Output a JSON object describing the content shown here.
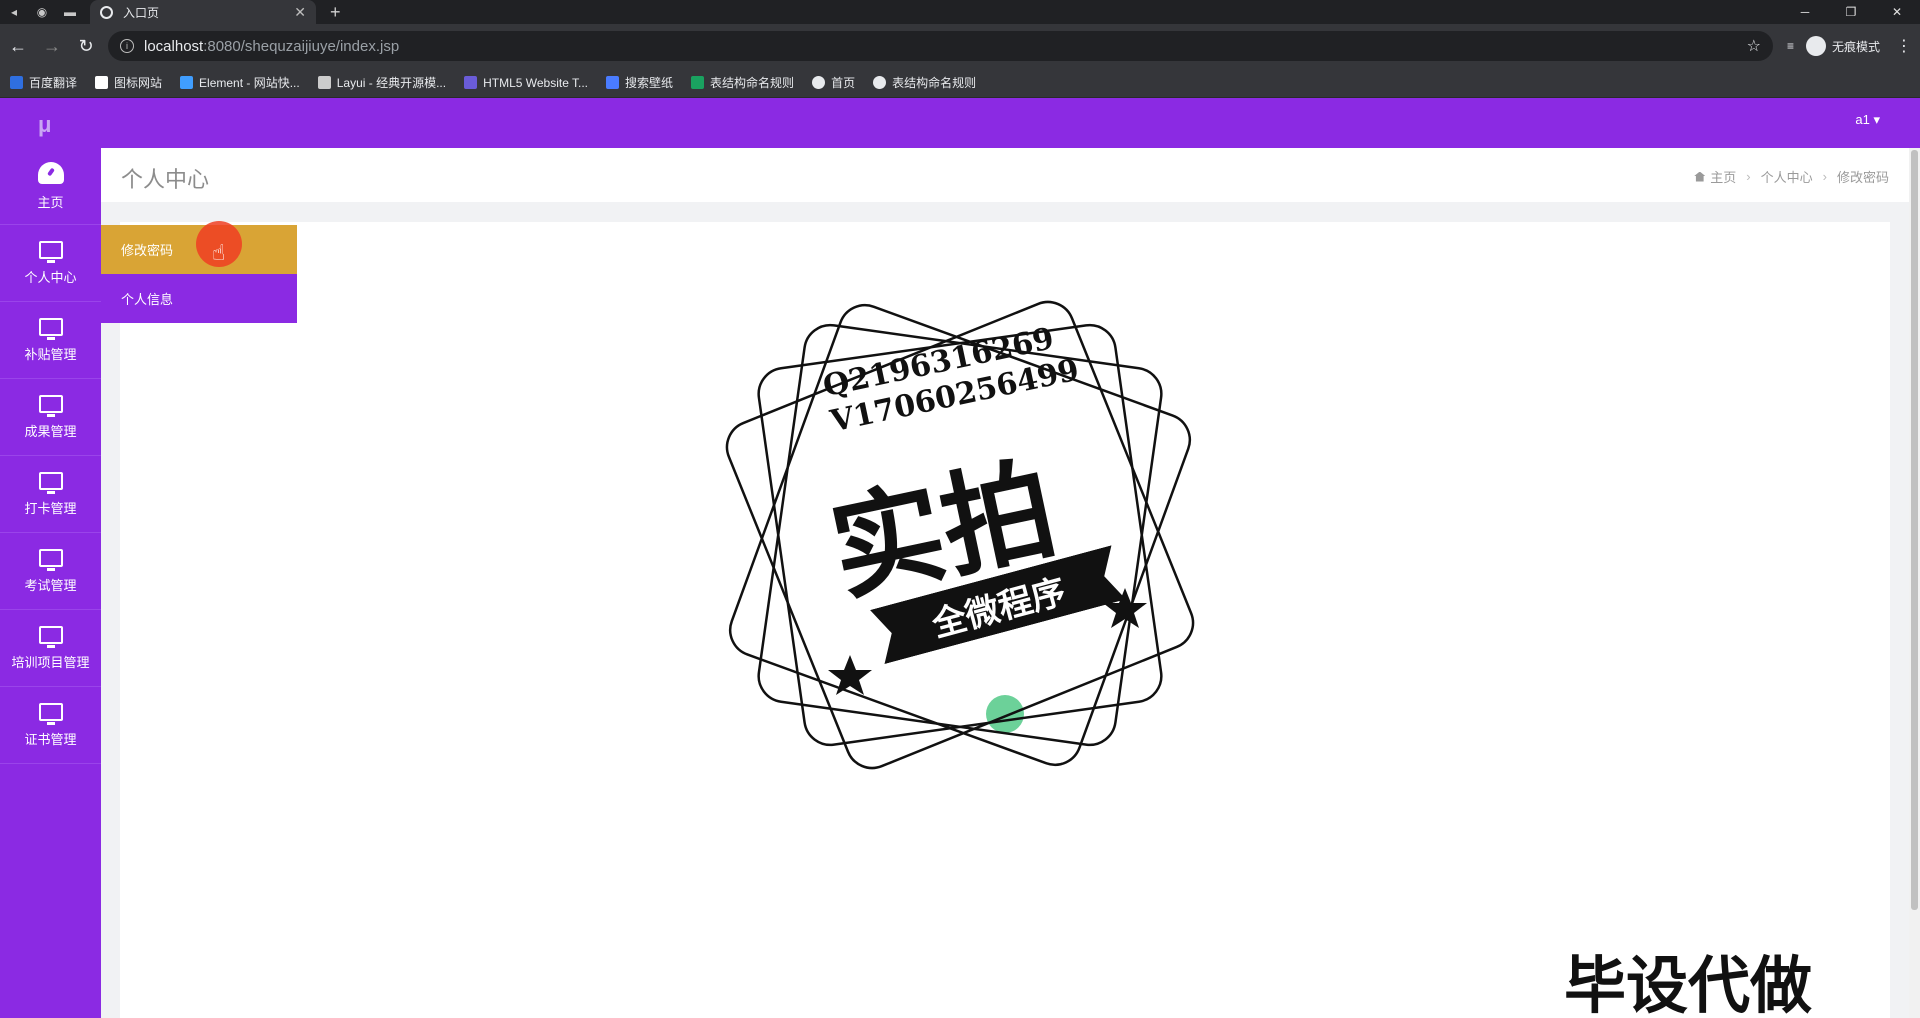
{
  "browser": {
    "tab_title": "入口页",
    "url_host": "localhost",
    "url_path": ":8080/shequzaijiuye/index.jsp",
    "profile_label": "无痕模式",
    "bookmarks": [
      {
        "label": "百度翻译",
        "color": "#2f6fe0"
      },
      {
        "label": "图标网站",
        "color": "#ffffff"
      },
      {
        "label": "Element - 网站快...",
        "color": "#409eff"
      },
      {
        "label": "Layui - 经典开源模...",
        "color": "#cccccc"
      },
      {
        "label": "HTML5 Website T...",
        "color": "#6a5cd8"
      },
      {
        "label": "搜索壁纸",
        "color": "#4a7cff"
      },
      {
        "label": "表结构命名规则",
        "color": "#1aa260"
      },
      {
        "label": "首页",
        "color": "#e8eaed"
      },
      {
        "label": "表结构命名规则",
        "color": "#e8eaed"
      }
    ]
  },
  "app": {
    "logo_text": "μ",
    "user_label": "a1 ▾",
    "sidebar": [
      {
        "label": "主页",
        "icon": "dashboard-icon"
      },
      {
        "label": "个人中心",
        "icon": "monitor-icon"
      },
      {
        "label": "补贴管理",
        "icon": "monitor-icon"
      },
      {
        "label": "成果管理",
        "icon": "monitor-icon"
      },
      {
        "label": "打卡管理",
        "icon": "monitor-icon"
      },
      {
        "label": "考试管理",
        "icon": "monitor-icon"
      },
      {
        "label": "培训项目管理",
        "icon": "monitor-icon"
      },
      {
        "label": "证书管理",
        "icon": "monitor-icon"
      }
    ],
    "page_title": "个人中心",
    "breadcrumb": [
      "主页",
      "个人中心",
      "修改密码"
    ],
    "submenu": [
      {
        "label": "修改密码",
        "active": true
      },
      {
        "label": "个人信息",
        "active": false
      }
    ],
    "colors": {
      "primary": "#8b2ae3",
      "active": "#d9a435"
    }
  },
  "watermark": {
    "qq": "Q2196316269",
    "vx": "V17060256499",
    "big": "实拍",
    "ribbon": "全微程序",
    "corner": "毕设代做"
  }
}
